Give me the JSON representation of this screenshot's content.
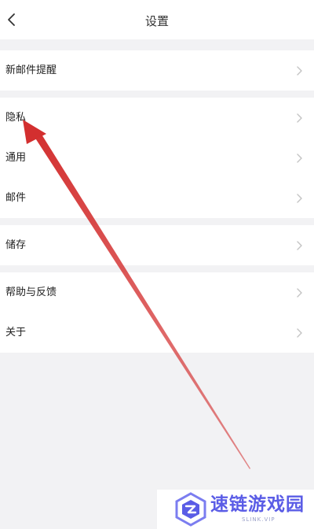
{
  "header": {
    "title": "设置"
  },
  "groups": [
    {
      "items": [
        {
          "label": "新邮件提醒"
        }
      ]
    },
    {
      "items": [
        {
          "label": "隐私"
        },
        {
          "label": "通用"
        },
        {
          "label": "邮件"
        }
      ]
    },
    {
      "items": [
        {
          "label": "储存"
        }
      ]
    },
    {
      "items": [
        {
          "label": "帮助与反馈"
        },
        {
          "label": "关于"
        }
      ]
    }
  ],
  "icons": {
    "back": "chevron-left-icon",
    "row_chevron": "chevron-right-icon"
  },
  "watermark": {
    "brand_text": "速链游戏园",
    "url_text": "SLINK.VIP"
  },
  "colors": {
    "background": "#f2f2f4",
    "card": "#ffffff",
    "annotation_arrow": "#d32f2f",
    "watermark_brand": "#5a5ce6"
  }
}
